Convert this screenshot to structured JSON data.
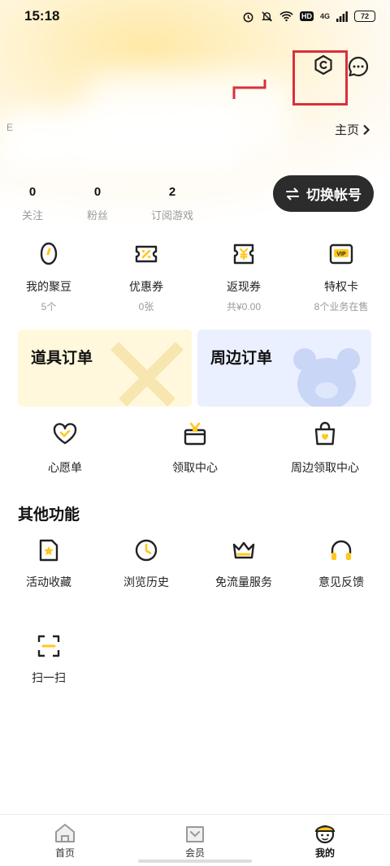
{
  "status_bar": {
    "time": "15:18",
    "network": "4G",
    "hd": "HD",
    "battery": "72"
  },
  "header": {
    "homepage_label": "主页",
    "edge_char": "E",
    "stats": [
      {
        "value": "0",
        "label": "关注"
      },
      {
        "value": "0",
        "label": "粉丝"
      },
      {
        "value": "2",
        "label": "订阅游戏"
      }
    ],
    "switch_account_label": "切换帐号"
  },
  "wallet": [
    {
      "title": "我的聚豆",
      "sub": "5个",
      "icon": "bean-icon"
    },
    {
      "title": "优惠券",
      "sub": "0张",
      "icon": "coupon-icon"
    },
    {
      "title": "返现券",
      "sub": "共¥0.00",
      "icon": "cashback-coupon-icon"
    },
    {
      "title": "特权卡",
      "sub": "8个业务在售",
      "icon": "vip-card-icon"
    }
  ],
  "orders": {
    "item_order_label": "道具订单",
    "merch_order_label": "周边订单"
  },
  "shortcuts": [
    {
      "label": "心愿单",
      "icon": "heart-icon"
    },
    {
      "label": "领取中心",
      "icon": "gift-icon"
    },
    {
      "label": "周边领取中心",
      "icon": "shopping-bag-icon"
    }
  ],
  "other": {
    "title": "其他功能",
    "items": [
      {
        "label": "活动收藏",
        "icon": "bookmark-star-icon"
      },
      {
        "label": "浏览历史",
        "icon": "clock-icon"
      },
      {
        "label": "免流量服务",
        "icon": "crown-icon"
      },
      {
        "label": "意见反馈",
        "icon": "headphones-icon"
      },
      {
        "label": "扫一扫",
        "icon": "scan-icon"
      }
    ]
  },
  "bottom_nav": [
    {
      "label": "首页",
      "icon": "home-icon",
      "active": false
    },
    {
      "label": "会员",
      "icon": "member-icon",
      "active": false
    },
    {
      "label": "我的",
      "icon": "avatar-icon",
      "active": true
    }
  ],
  "colors": {
    "accent": "#ffc81e",
    "dark_button": "#2c2c2c",
    "highlight_box": "#d9303b"
  }
}
